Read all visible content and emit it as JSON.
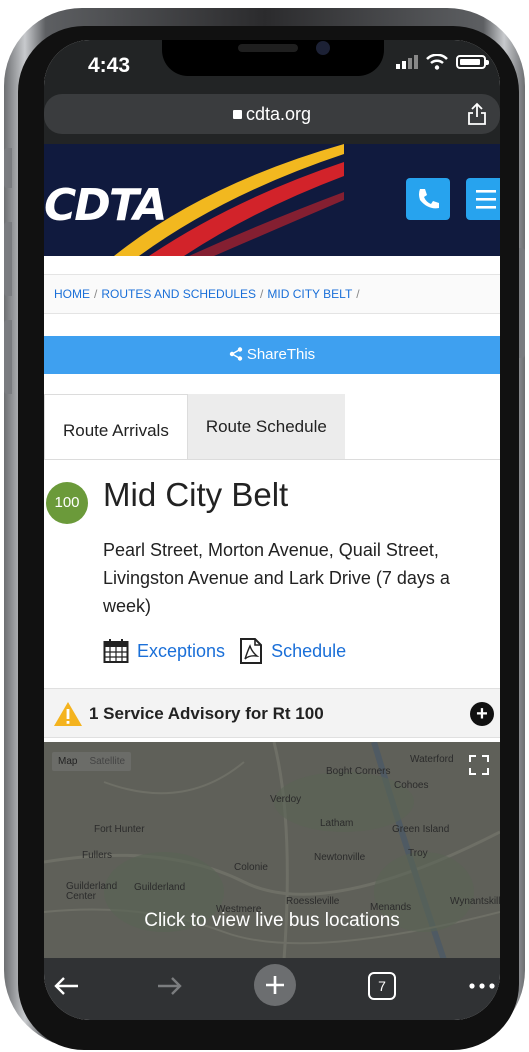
{
  "status": {
    "time": "4:43"
  },
  "browser": {
    "url": "cdta.org"
  },
  "header": {
    "logo_text": "CDTA"
  },
  "breadcrumb": {
    "items": [
      "HOME",
      "ROUTES AND SCHEDULES",
      "MID CITY BELT"
    ]
  },
  "sharebar": {
    "label": "ShareThis"
  },
  "tabs": [
    {
      "label": "Route Arrivals",
      "active": true
    },
    {
      "label": "Route Schedule",
      "active": false
    }
  ],
  "route": {
    "number": "100",
    "title": "Mid City Belt",
    "description": "Pearl Street, Morton Avenue, Quail Street, Livingston Avenue and Lark Drive (7 days a week)",
    "links": {
      "exceptions": "Exceptions",
      "schedule": "Schedule"
    }
  },
  "advisory": {
    "text": "1 Service Advisory for Rt 100"
  },
  "map": {
    "toggle": [
      "Map",
      "Satellite"
    ],
    "labels": [
      "Waterford",
      "Boght Corners",
      "Cohoes",
      "Verdoy",
      "Fort Hunter",
      "Latham",
      "Green Island",
      "Fullers",
      "Newtonville",
      "Troy",
      "Colonie",
      "Guilderland Center",
      "Guilderland",
      "Westmere",
      "Roessleville",
      "Menands",
      "Wynantskill"
    ],
    "cta": "Click to view live bus locations"
  },
  "toolbar": {
    "tab_count": "7"
  },
  "colors": {
    "header_bg": "#101a3e",
    "accent": "#27a3ee",
    "route_badge": "#6b9a3a",
    "link": "#1a6fd8"
  }
}
